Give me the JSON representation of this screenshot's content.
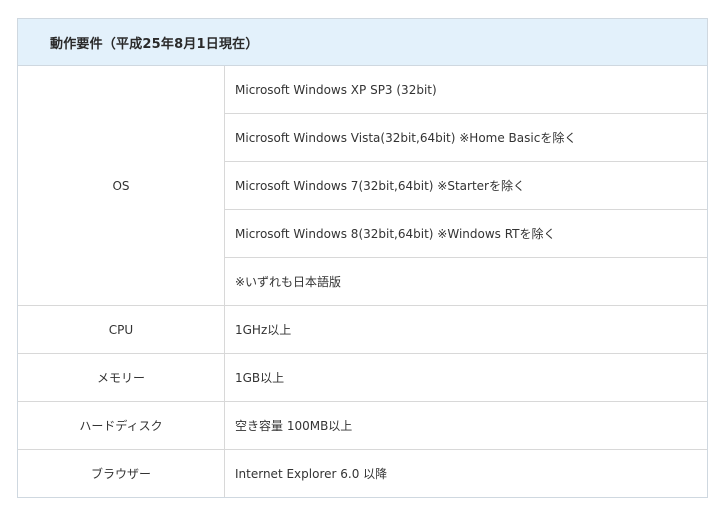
{
  "header": {
    "title": "動作要件（平成25年8月1日現在）"
  },
  "rows": [
    {
      "label": "OS",
      "values": [
        "Microsoft Windows XP SP3 (32bit)",
        "Microsoft Windows Vista(32bit,64bit) ※Home Basicを除く",
        "Microsoft Windows 7(32bit,64bit) ※Starterを除く",
        "Microsoft Windows 8(32bit,64bit) ※Windows RTを除く",
        "※いずれも日本語版"
      ]
    },
    {
      "label": "CPU",
      "values": [
        "1GHz以上"
      ]
    },
    {
      "label": "メモリー",
      "values": [
        "1GB以上"
      ]
    },
    {
      "label": "ハードディスク",
      "values": [
        "空き容量 100MB以上"
      ]
    },
    {
      "label": "ブラウザー",
      "values": [
        "Internet Explorer 6.0 以降"
      ]
    }
  ],
  "colors": {
    "header_bg": "#e3f1fb",
    "border": "#d8d8d8",
    "text": "#333333"
  }
}
